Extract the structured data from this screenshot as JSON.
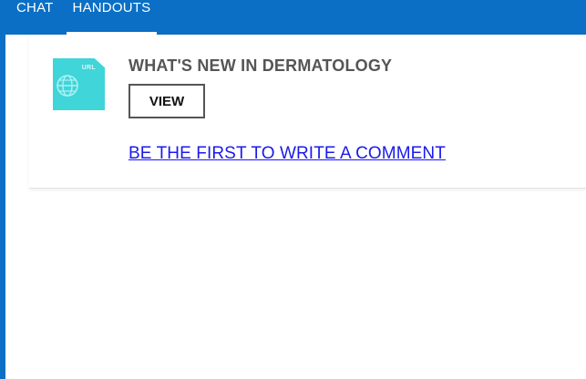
{
  "tabs": [
    {
      "label": "CHAT",
      "active": false
    },
    {
      "label": "HANDOUTS",
      "active": true
    }
  ],
  "handouts": [
    {
      "thumbnail_label": "URL",
      "thumbnail_icon": "globe-icon",
      "title": "WHAT'S NEW IN DERMATOLOGY",
      "view_label": "VIEW",
      "comment_link": "BE THE FIRST TO WRITE A COMMENT"
    }
  ],
  "colors": {
    "accent": "#0a6fc5",
    "thumbnail": "#3fd5d9",
    "link": "#1a1aee",
    "title": "#555555"
  }
}
